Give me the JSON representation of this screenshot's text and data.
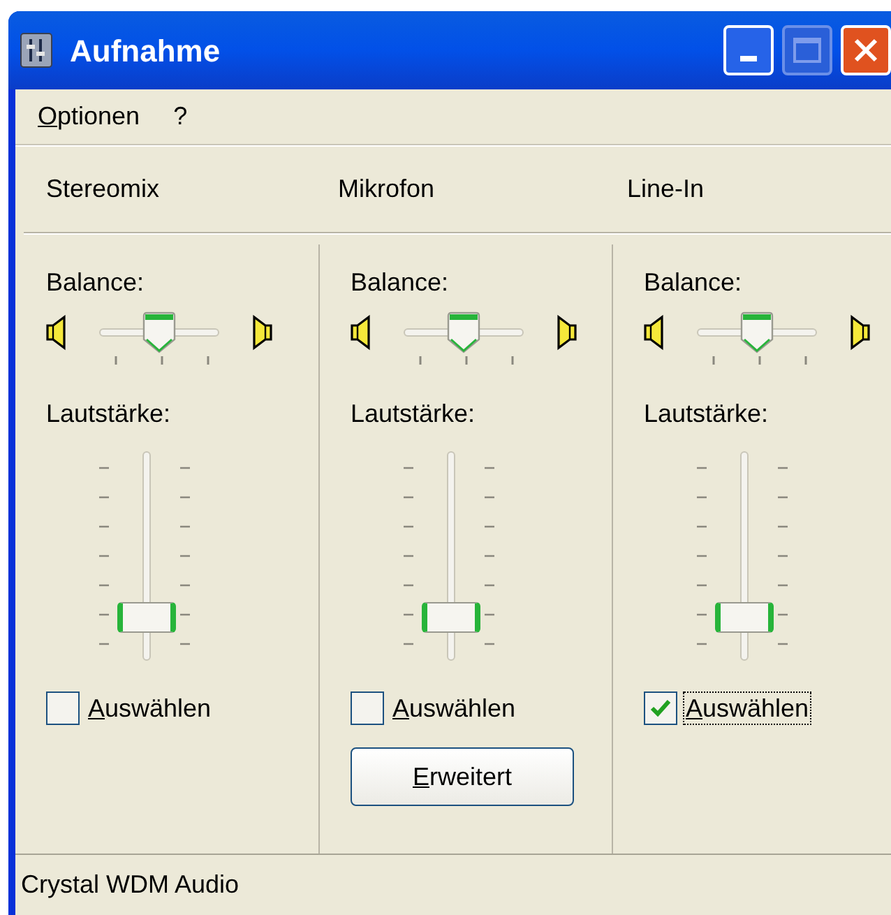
{
  "window": {
    "title": "Aufnahme"
  },
  "menu": [
    {
      "label": "Optionen"
    },
    {
      "label": "?"
    }
  ],
  "channels": [
    {
      "name": "Stereomix",
      "balance_label": "Balance:",
      "volume_label": "Lautstärke:",
      "volume": {
        "level": 0.13
      },
      "select": {
        "label": "Auswählen",
        "checked": false,
        "focused": false
      }
    },
    {
      "name": "Mikrofon",
      "balance_label": "Balance:",
      "volume_label": "Lautstärke:",
      "volume": {
        "level": 0.13
      },
      "select": {
        "label": "Auswählen",
        "checked": false,
        "focused": false
      },
      "button": "Erweitert"
    },
    {
      "name": "Line-In",
      "balance_label": "Balance:",
      "volume_label": "Lautstärke:",
      "volume": {
        "level": 0.13
      },
      "select": {
        "label": "Auswählen",
        "checked": true,
        "focused": true
      }
    }
  ],
  "status_bar": "Crystal WDM Audio"
}
